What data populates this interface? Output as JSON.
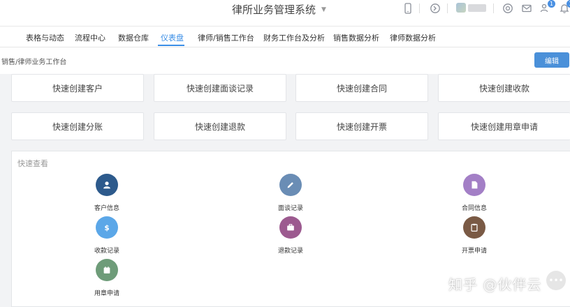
{
  "header": {
    "title": "律所业务管理系统",
    "caret_icon": "caret-down-icon",
    "badges": {
      "notifications": "1",
      "users": "1"
    }
  },
  "tabs": [
    {
      "label": "表格与动态"
    },
    {
      "label": "流程中心"
    },
    {
      "label": "数据仓库"
    },
    {
      "label": "仪表盘",
      "active": true
    },
    {
      "label": "律师/销售工作台"
    },
    {
      "label": "财务工作台及分析"
    },
    {
      "label": "销售数据分析"
    },
    {
      "label": "律师数据分析"
    }
  ],
  "breadcrumb": "销售/律师业务工作台",
  "edit_label": "编辑",
  "quick_create": [
    "快速创建客户",
    "快速创建面谈记录",
    "快速创建合同",
    "快速创建收款",
    "快速创建分账",
    "快速创建退款",
    "快速创建开票",
    "快速创建用章申请"
  ],
  "quick_view": {
    "title": "快速查看",
    "items": [
      {
        "label": "客户信息",
        "icon": "user-icon",
        "color": "#2d5a8c"
      },
      {
        "label": "面谈记录",
        "icon": "pencil-icon",
        "color": "#6a8db5"
      },
      {
        "label": "合同信息",
        "icon": "document-icon",
        "color": "#a37fc6"
      },
      {
        "label": "收款记录",
        "icon": "dollar-icon",
        "color": "#5ba7e8"
      },
      {
        "label": "退款记录",
        "icon": "briefcase-icon",
        "color": "#9c5a8f"
      },
      {
        "label": "开票申请",
        "icon": "clipboard-icon",
        "color": "#7a5a45"
      },
      {
        "label": "用章申请",
        "icon": "calendar-icon",
        "color": "#6e9c79"
      }
    ]
  },
  "watermark": "知乎 @伙伴云"
}
